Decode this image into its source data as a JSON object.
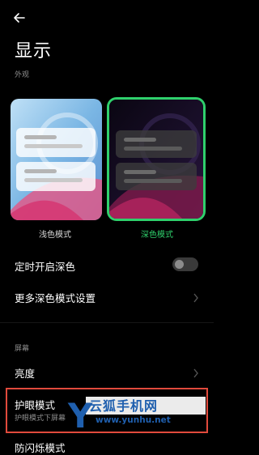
{
  "header": {
    "title": "显示",
    "back_icon": "back-arrow-icon"
  },
  "appearance": {
    "section_label": "外观",
    "options": [
      {
        "label": "浅色模式",
        "selected": false
      },
      {
        "label": "深色模式",
        "selected": true
      }
    ],
    "selected_color": "#2fd06c"
  },
  "settings": {
    "schedule_dark": {
      "label": "定时开启深色",
      "enabled": false
    },
    "more_dark_settings": {
      "label": "更多深色模式设置"
    }
  },
  "screen": {
    "section_label": "屏幕",
    "brightness": {
      "label": "亮度"
    },
    "eye_care": {
      "label": "护眼模式",
      "description": "护眼模式下屏幕"
    },
    "next_item": {
      "label": "防闪烁模式"
    }
  },
  "watermark": {
    "brand": "云狐手机网",
    "letter": "Y",
    "url": "www.yunhu.net"
  },
  "colors": {
    "background": "#000000",
    "highlight_border": "#e14a3c"
  }
}
